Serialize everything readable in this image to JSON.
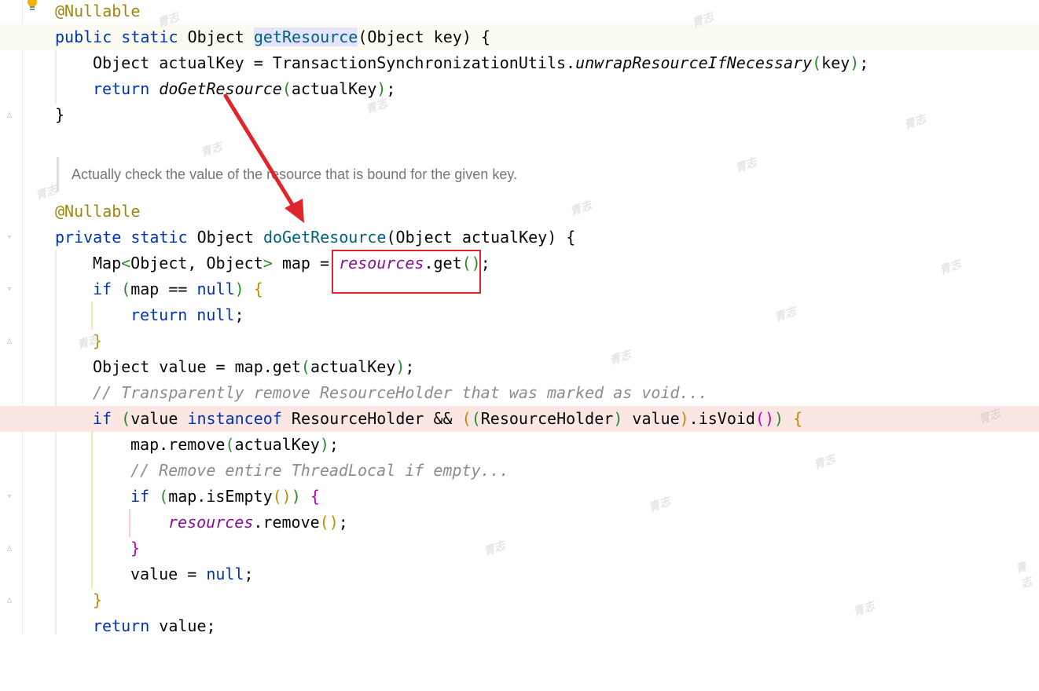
{
  "editor": {
    "doc_comment": "Actually check the value of the resource that is bound for the given key.",
    "lines": {
      "l1_ann": "@Nullable",
      "l2_public": "public",
      "l2_static": "static",
      "l2_type": "Object",
      "l2_name": "getResource",
      "l2_open": "(",
      "l2_params": "Object key",
      "l2_close": ")",
      "l2_brace": "{",
      "l3_a": "Object actualKey = TransactionSynchronizationUtils.",
      "l3_call": "unwrapResourceIfNecessary",
      "l3_args": "key",
      "l3_end": ";",
      "l4_return": "return",
      "l4_call": "doGetResource",
      "l4_args": "actualKey",
      "l4_end": ";",
      "l5": "}",
      "l6_ann": "@Nullable",
      "l7_private": "private",
      "l7_static": "static",
      "l7_type": "Object",
      "l7_name": "doGetResource",
      "l7_params": "Object actualKey",
      "l7_brace": "{",
      "l8_a": "Map",
      "l8_generic_open": "<",
      "l8_generic": "Object, Object",
      "l8_generic_close": ">",
      "l8_b": " map = ",
      "l8_field": "resources",
      "l8_c": ".get",
      "l8_end": ";",
      "l9_if": "if",
      "l9_cond": "map == ",
      "l9_null": "null",
      "l9_brace": "{",
      "l10_return": "return",
      "l10_null": "null",
      "l10_end": ";",
      "l11": "}",
      "l12_a": "Object value = map.get",
      "l12_args": "actualKey",
      "l12_end": ";",
      "l13_comment": "// Transparently remove ResourceHolder that was marked as void...",
      "l14_if": "if",
      "l14_value": "value ",
      "l14_instanceof": "instanceof",
      "l14_b": " ResourceHolder && ",
      "l14_cast": "ResourceHolder",
      "l14_c": " value",
      "l14_d": ".isVoid",
      "l14_brace": "{",
      "l15_a": "map.remove",
      "l15_args": "actualKey",
      "l15_end": ";",
      "l16_comment": "// Remove entire ThreadLocal if empty...",
      "l17_if": "if",
      "l17_cond": "map.isEmpty",
      "l17_brace": "{",
      "l18_field": "resources",
      "l18_b": ".remove",
      "l18_end": ";",
      "l19": "}",
      "l20_a": "value = ",
      "l20_null": "null",
      "l20_end": ";",
      "l21": "}",
      "l22_return": "return",
      "l22_b": " value;"
    }
  },
  "icons": {
    "bulb": "lightbulb-icon",
    "fold": "fold-marker-icon"
  },
  "annotation": {
    "arrow_color": "#e0242c",
    "box_color": "#e0242c"
  },
  "watermark": "青志"
}
